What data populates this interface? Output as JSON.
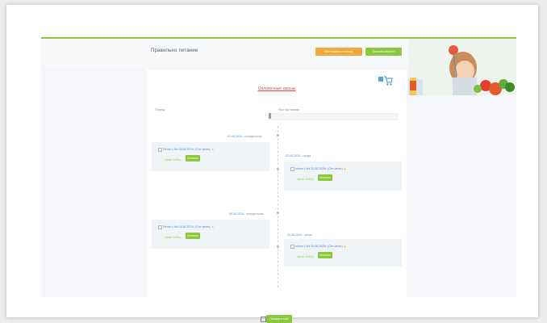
{
  "header": {
    "logo_text": "Правильно питание",
    "orange_button": "Мои заказы и отзывы",
    "green_button": "Личный кабинет"
  },
  "main": {
    "section_title": "Оплаченные заказы",
    "filter_left_label": "Период",
    "filter_right_label": "Мои программы"
  },
  "entries": [
    {
      "side": "left",
      "date": "01.05.2024",
      "day": "понедельник",
      "title": "Меню 4 На 05.05.2024г. (Сет меню)",
      "price": "Цена: 0.00 р",
      "order_label": "Оплатить"
    },
    {
      "side": "right",
      "date": "22.05.2024",
      "day": "среда",
      "title": "Меню 4 На 22.05.2024г. (Сет меню)",
      "price": "Цена: 0.00 р",
      "order_label": "Оплатить"
    },
    {
      "side": "left",
      "date": "04.06.2024",
      "day": "понедельник",
      "title": "Меню 4 На 04.06.2024г. (Сет меню)",
      "price": "Цена: 0.00 р",
      "order_label": "Оплатить"
    },
    {
      "side": "right",
      "date": "20.06.2024",
      "day": "среда",
      "title": "Меню 4 На 20.06.2024г. (Сет меню)",
      "price": "Цена: 0.00 р",
      "order_label": "Оплатить"
    }
  ],
  "footer": {
    "more_button": "Показать ещё"
  },
  "colors": {
    "accent_green": "#8cc63f",
    "accent_orange": "#f1a93b",
    "link_blue": "#4f8ac9",
    "title_red": "#e04848"
  },
  "icons": [
    "cart-icon",
    "warning-icon",
    "calendar-icon"
  ]
}
